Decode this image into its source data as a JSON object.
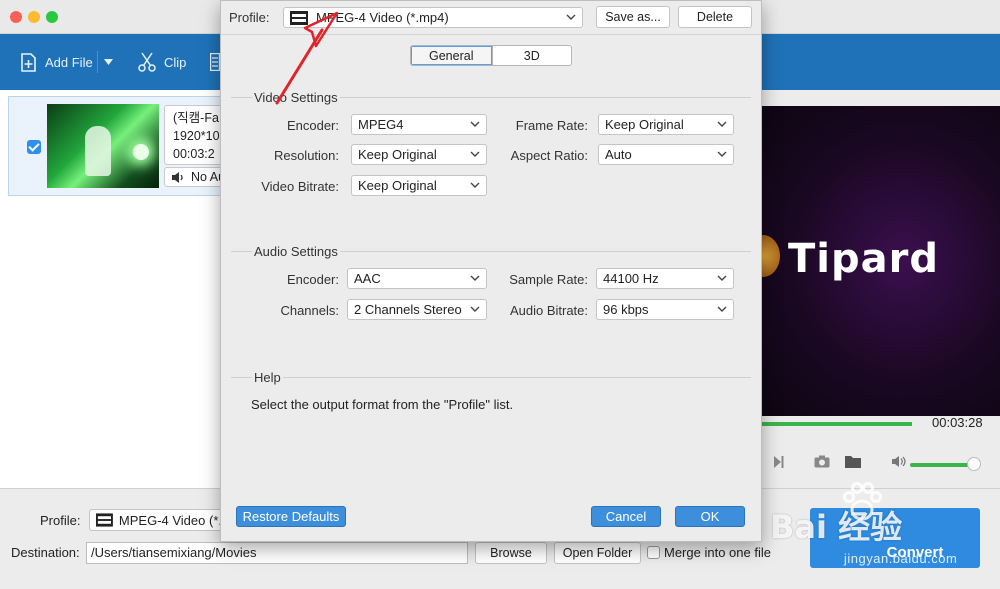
{
  "toolbar": {
    "add_file_label": "Add File",
    "clip_label": "Clip"
  },
  "file_item": {
    "title": "(직캠-Fa",
    "resolution": "1920*10",
    "duration": "00:03:2",
    "audio_track": "No Au",
    "checked": true
  },
  "preview": {
    "logo_text": "Tipard",
    "time": "00:03:28"
  },
  "bottom": {
    "profile_label": "Profile:",
    "profile_value": "MPEG-4 Video (*.",
    "destination_label": "Destination:",
    "destination_value": "/Users/tiansemixiang/Movies",
    "browse_label": "Browse",
    "open_folder_label": "Open Folder",
    "merge_label": "Merge into one file",
    "convert_label": "Convert"
  },
  "watermark": {
    "main": "Bai 经验",
    "sub": "jingyan.baidu.com"
  },
  "dialog": {
    "profile_label": "Profile:",
    "profile_value": "MPEG-4 Video (*.mp4)",
    "save_as_label": "Save as...",
    "delete_label": "Delete",
    "tabs": [
      "General",
      "3D"
    ],
    "video_settings": {
      "title": "Video Settings",
      "encoder_label": "Encoder:",
      "encoder_value": "MPEG4",
      "frame_rate_label": "Frame Rate:",
      "frame_rate_value": "Keep Original",
      "resolution_label": "Resolution:",
      "resolution_value": "Keep Original",
      "aspect_ratio_label": "Aspect Ratio:",
      "aspect_ratio_value": "Auto",
      "bitrate_label": "Video Bitrate:",
      "bitrate_value": "Keep Original"
    },
    "audio_settings": {
      "title": "Audio Settings",
      "encoder_label": "Encoder:",
      "encoder_value": "AAC",
      "sample_rate_label": "Sample Rate:",
      "sample_rate_value": "44100 Hz",
      "channels_label": "Channels:",
      "channels_value": "2 Channels Stereo",
      "bitrate_label": "Audio Bitrate:",
      "bitrate_value": "96 kbps"
    },
    "help": {
      "title": "Help",
      "text": "Select the output format from the \"Profile\" list."
    },
    "restore_defaults_label": "Restore Defaults",
    "cancel_label": "Cancel",
    "ok_label": "OK"
  },
  "colors": {
    "toolbar_blue": "#1f72b8",
    "accent_blue": "#3d8fdc",
    "progress_green": "#3bb54a",
    "annotation_red": "#e0242b"
  }
}
